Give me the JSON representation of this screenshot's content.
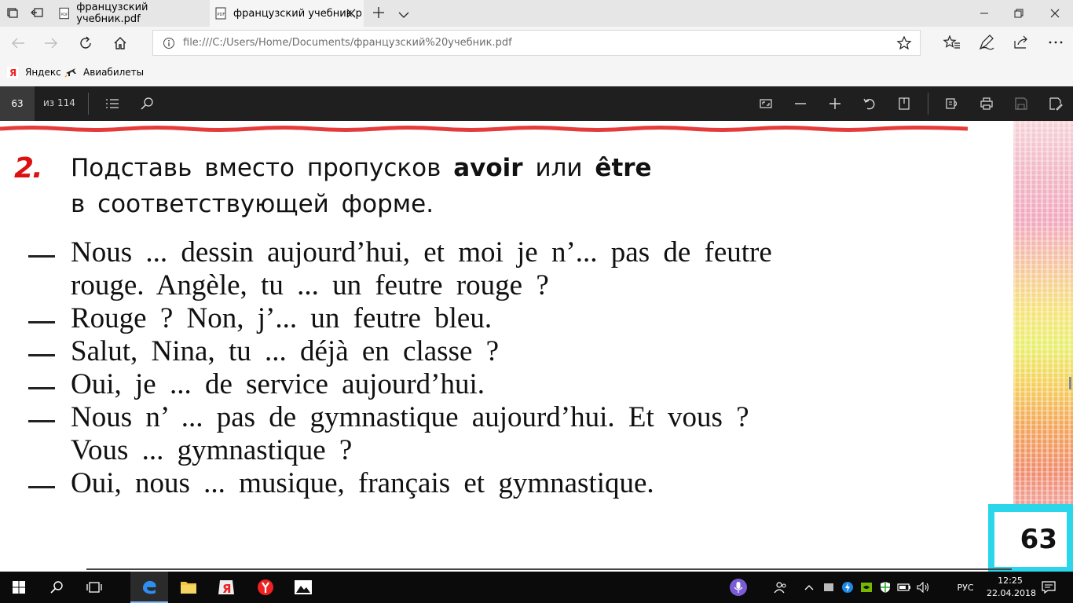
{
  "browser": {
    "tabs": [
      {
        "label": "французский учебник.pdf"
      },
      {
        "label": "французский учебник.p"
      }
    ],
    "address": "file:///C:/Users/Home/Documents/французский%20учебник.pdf",
    "favorites": [
      {
        "label": "Яндекс"
      },
      {
        "label": "Авиабилеты"
      }
    ]
  },
  "pdf_toolbar": {
    "page_current": "63",
    "page_total": "из 114"
  },
  "document": {
    "exercise_number": "2.",
    "instruction_line1_a": "Подставь вместо пропусков ",
    "instruction_bold1": "avoir",
    "instruction_line1_b": " или ",
    "instruction_bold2": "être",
    "instruction_line2": "в соответствующей форме.",
    "lines": [
      "Nous ... dessin aujourd’hui, et moi je n’... pas de feutre",
      "rouge. Angèle, tu ... un feutre rouge ?",
      "Rouge ? Non, j’... un feutre bleu.",
      "Salut, Nina, tu ... déjà en classe ?",
      "Oui, je ... de service aujourd’hui.",
      "Nous n’ ... pas de gymnastique aujourd’hui. Et vous ?",
      "Vous ... gymnastique ?",
      "Oui, nous ... musique, français et gymnastique."
    ],
    "page_number": "63"
  },
  "taskbar": {
    "language": "РУС",
    "time": "12:25",
    "date": "22.04.2018"
  }
}
